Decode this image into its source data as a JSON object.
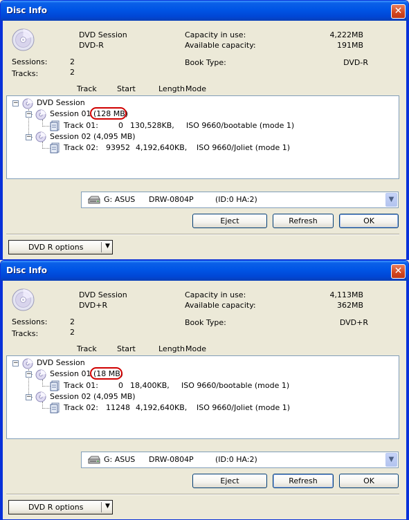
{
  "windows": [
    {
      "title": "Disc Info",
      "close_glyph": "✕",
      "disc_type": "DVD Session",
      "media": "DVD-R",
      "capacity_in_use_label": "Capacity in use:",
      "capacity_in_use": "4,222MB",
      "available_capacity_label": "Available capacity:",
      "available_capacity": "191MB",
      "sessions_label": "Sessions:",
      "sessions": "2",
      "tracks_label": "Tracks:",
      "tracks": "2",
      "book_type_label": "Book Type:",
      "book_type": "DVD-R",
      "columns": {
        "track": "Track",
        "start": "Start",
        "length": "Length",
        "mode": "Mode"
      },
      "tree": {
        "root": "DVD Session",
        "session1_name": "Session 01 ",
        "session1_size": "(128 MB)",
        "track1": {
          "label": "Track 01:",
          "start": "0",
          "length": "130,528KB,",
          "mode": "ISO 9660/bootable (mode 1)"
        },
        "session2": "Session 02 (4,095 MB)",
        "track2": {
          "label": "Track 02:",
          "start": "93952",
          "length": "4,192,640KB,",
          "mode": "ISO 9660/Joliet (mode 1)"
        }
      },
      "drive": {
        "letter": "G: ASUS",
        "model": "DRW-0804P",
        "id": "(ID:0  HA:2)"
      },
      "buttons": {
        "eject": "Eject",
        "refresh": "Refresh",
        "ok": "OK"
      },
      "options_label": "DVD R options",
      "options_arrow": "▼"
    },
    {
      "title": "Disc Info",
      "close_glyph": "✕",
      "disc_type": "DVD Session",
      "media": "DVD+R",
      "capacity_in_use_label": "Capacity in use:",
      "capacity_in_use": "4,113MB",
      "available_capacity_label": "Available capacity:",
      "available_capacity": "362MB",
      "sessions_label": "Sessions:",
      "sessions": "2",
      "tracks_label": "Tracks:",
      "tracks": "2",
      "book_type_label": "Book Type:",
      "book_type": "DVD+R",
      "columns": {
        "track": "Track",
        "start": "Start",
        "length": "Length",
        "mode": "Mode"
      },
      "tree": {
        "root": "DVD Session",
        "session1_name": "Session 01 ",
        "session1_size": "(18 MB)",
        "track1": {
          "label": "Track 01:",
          "start": "0",
          "length": "18,400KB,",
          "mode": "ISO 9660/bootable (mode 1)"
        },
        "session2": "Session 02 (4,095 MB)",
        "track2": {
          "label": "Track 02:",
          "start": "11248",
          "length": "4,192,640KB,",
          "mode": "ISO 9660/Joliet (mode 1)"
        }
      },
      "drive": {
        "letter": "G: ASUS",
        "model": "DRW-0804P",
        "id": "(ID:0  HA:2)"
      },
      "buttons": {
        "eject": "Eject",
        "refresh": "Refresh",
        "ok": "OK"
      },
      "options_label": "DVD R options",
      "options_arrow": "▼"
    }
  ],
  "colors": {
    "title_blue": "#0055E5",
    "highlight_red": "#D00000",
    "dialog_bg": "#ECE9D8"
  }
}
